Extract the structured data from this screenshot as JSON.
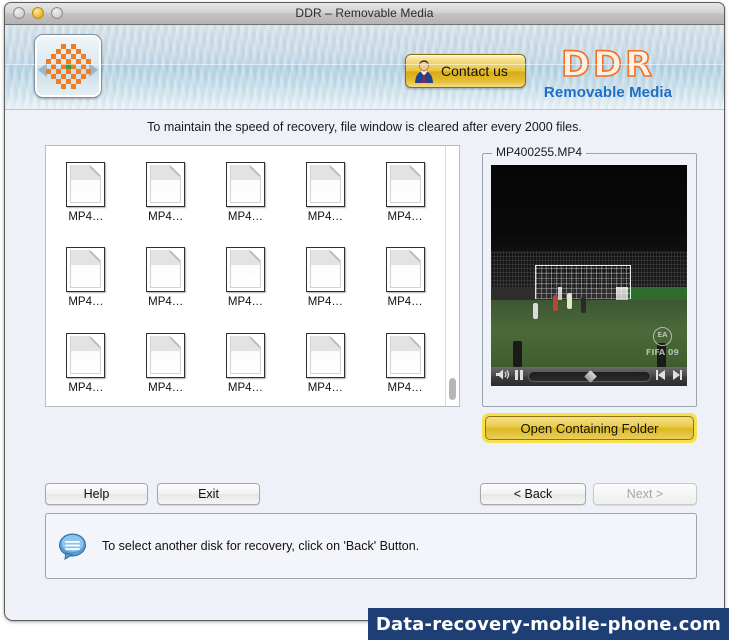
{
  "window": {
    "title": "DDR – Removable Media",
    "traffic_lights": [
      "close",
      "minimize",
      "zoom"
    ]
  },
  "header": {
    "logo_icon": "ddr-app-logo-icon",
    "contact_button": {
      "label": "Contact us",
      "icon": "person-icon"
    },
    "brand": {
      "name": "DDR",
      "subtitle": "Removable Media"
    }
  },
  "main": {
    "notice": "To maintain the speed of recovery, file window is cleared after every 2000 files.",
    "file_list": {
      "columns": 5,
      "rows": 3,
      "item_icon": "file-document-icon",
      "items": [
        {
          "label": "MP4…"
        },
        {
          "label": "MP4…"
        },
        {
          "label": "MP4…"
        },
        {
          "label": "MP4…"
        },
        {
          "label": "MP4…"
        },
        {
          "label": "MP4…"
        },
        {
          "label": "MP4…"
        },
        {
          "label": "MP4…"
        },
        {
          "label": "MP4…"
        },
        {
          "label": "MP4…"
        },
        {
          "label": "MP4…"
        },
        {
          "label": "MP4…"
        },
        {
          "label": "MP4…"
        },
        {
          "label": "MP4…"
        },
        {
          "label": "MP4…"
        }
      ],
      "scrollbar": {
        "position": "bottom"
      }
    },
    "preview": {
      "group_title": "MP400255.MP4",
      "video_caption": "FIFA 09",
      "video_brand": "EA",
      "controls": {
        "volume_icon": "speaker-icon",
        "pause_icon": "pause-icon",
        "step_back_icon": "step-backward-icon",
        "step_forward_icon": "step-forward-icon",
        "scrubber_position_percent": 50
      }
    },
    "open_folder_button": "Open Containing Folder"
  },
  "footer_buttons": {
    "help": "Help",
    "exit": "Exit",
    "back": "< Back",
    "next": "Next >",
    "next_disabled": true
  },
  "status": {
    "icon": "speech-bubble-icon",
    "message": "To select another disk for recovery, click on 'Back' Button."
  },
  "watermark": {
    "text": "Data-recovery-mobile-phone.com"
  },
  "colors": {
    "brand_orange": "#f4701f",
    "brand_blue": "#1f6fc4",
    "gold_button": "#e8c33d",
    "watermark_bg": "#1d3f75",
    "window_bg": "#eef1f8"
  }
}
